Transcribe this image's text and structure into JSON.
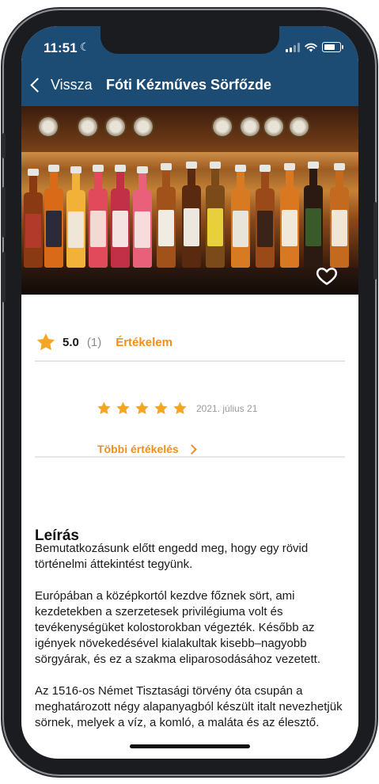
{
  "status": {
    "time": "11:51"
  },
  "nav": {
    "back_label": "Vissza",
    "title": "Fóti Kézműves Sörfőzde"
  },
  "colors": {
    "nav_bg": "#1c4b74",
    "accent": "#f0901a",
    "star": "#f5a623"
  },
  "rating": {
    "score": "5.0",
    "count": "(1)",
    "rate_link": "Értékelem"
  },
  "review": {
    "stars": 5,
    "date": "2021. július 21"
  },
  "more_reviews": "Többi értékelés",
  "description": {
    "heading": "Leírás",
    "paragraphs": [
      "Bemutatkozásunk előtt engedd meg, hogy egy rövid történelmi áttekintést tegyünk.",
      "Európában a középkortól kezdve főznek sört, ami kezdetekben a szerzetesek privilégiuma volt és tevékenységüket kolostorokban végezték. Később az igények növekedésével kialakultak kisebb–nagyobb sörgyárak, és ez a szakma eliparosodásához vezetett.",
      "Az 1516-os Német Tisztasági törvény óta csupán a meghatározott négy alapanyagból készült italt nevezhetjük sörnek, melyek a víz, a komló, a maláta és az élesztő."
    ]
  },
  "icons": {
    "back": "chevron-left-icon",
    "favorite": "heart-outline-icon",
    "star": "star-icon"
  }
}
